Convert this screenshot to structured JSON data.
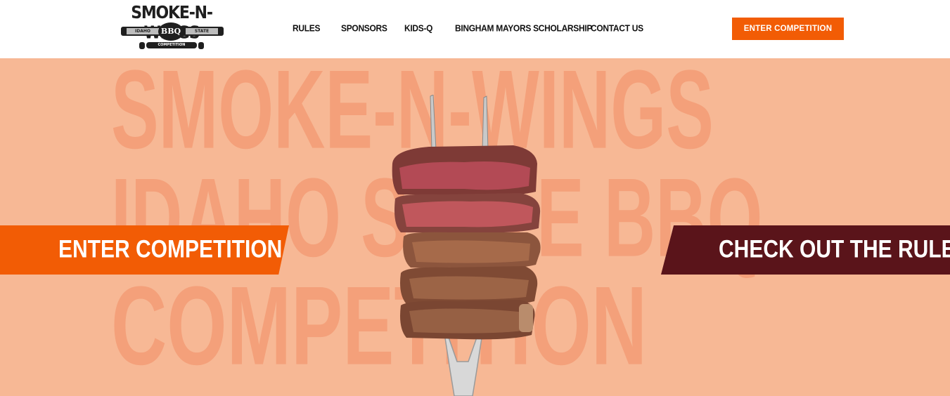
{
  "brand": {
    "title": "SMOKE-N-WINGS",
    "left_word": "IDAHO",
    "badge": "BBQ",
    "right_word": "STATE",
    "sub": "COMPETITION"
  },
  "nav": {
    "items": [
      {
        "label": "RULES"
      },
      {
        "label": "SPONSORS"
      },
      {
        "label": "KIDS-Q"
      },
      {
        "label": "BINGHAM MAYORS SCHOLARSHIP"
      },
      {
        "label": "CONTACT US"
      }
    ],
    "cta": "ENTER COMPETITION"
  },
  "hero": {
    "bg_lines": [
      "SMOKE-N-WINGS",
      "IDAHO STATE BBQ",
      "COMPETITION"
    ],
    "left_banner": "ENTER COMPETITION",
    "right_banner": "CHECK OUT THE RULES"
  },
  "colors": {
    "accent": "#f25c05",
    "dark_red": "#5a141a",
    "hero_bg": "#f7b895",
    "hero_text": "#f4a07a"
  }
}
